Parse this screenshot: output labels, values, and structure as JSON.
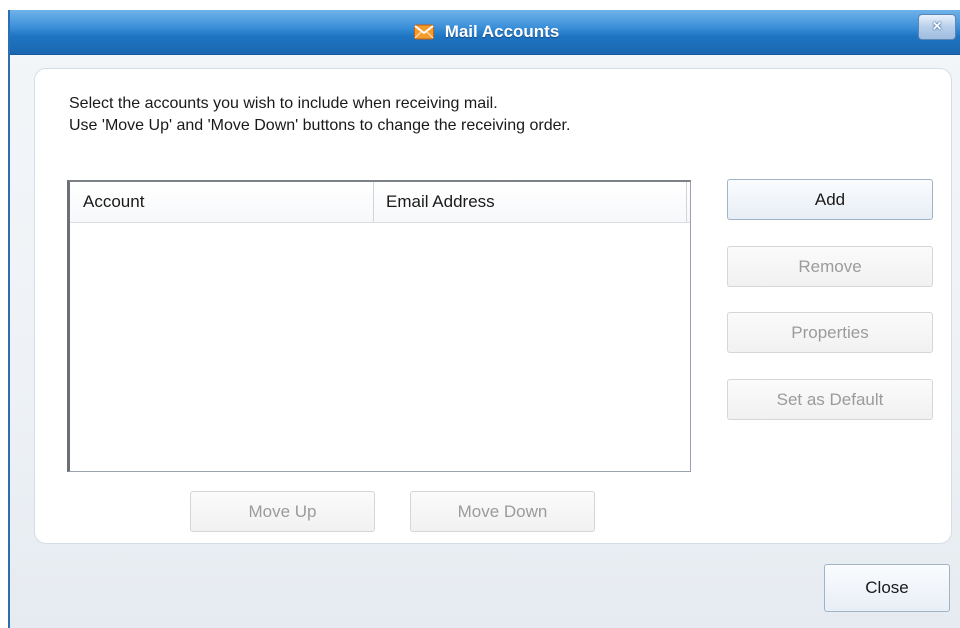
{
  "window": {
    "title": "Mail Accounts",
    "title_icon": "mail-envelope-icon",
    "close_glyph": "×"
  },
  "instructions": {
    "line1": "Select the accounts you wish to include when receiving mail.",
    "line2": "Use 'Move Up' and 'Move Down' buttons to change the receiving order."
  },
  "accounts_list": {
    "columns": [
      "Account",
      "Email Address"
    ],
    "rows": []
  },
  "buttons": {
    "add": "Add",
    "remove": "Remove",
    "properties": "Properties",
    "set_default": "Set as Default",
    "move_up": "Move Up",
    "move_down": "Move Down",
    "close": "Close"
  },
  "colors": {
    "titlebar": "#1f74c2",
    "icon_orange": "#f28a1e",
    "disabled_text": "#9b9b9b"
  }
}
